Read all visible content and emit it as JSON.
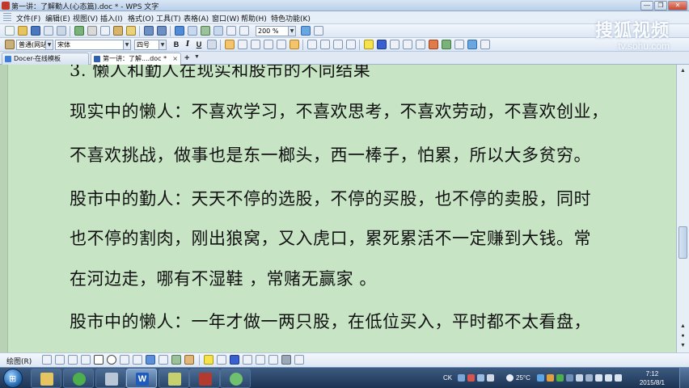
{
  "window": {
    "title": "第一讲：了解勤人(心态篇).doc * - WPS 文字",
    "minimize": "—",
    "restore": "❐",
    "close": "✕"
  },
  "menu": [
    "文件(F)",
    "编辑(E)",
    "视图(V)",
    "插入(I)",
    "格式(O)",
    "工具(T)",
    "表格(A)",
    "窗口(W)",
    "帮助(H)",
    "特色功能(K)"
  ],
  "toolbar": {
    "zoom": "200 %",
    "style": "普通(网站)",
    "font": "宋体",
    "size": "四号",
    "bold": "B",
    "italic": "I",
    "underline": "U"
  },
  "watermark": {
    "brand": "搜狐视频",
    "url": "tv.sohu.com"
  },
  "tabs": [
    {
      "label": "Docer-在线模板",
      "active": false
    },
    {
      "label": "第一讲：了解....doc *",
      "active": true
    }
  ],
  "new_tab": "+",
  "document": {
    "lines": [
      "3. 懒人和勤人在现实和股市的不同结果",
      "现实中的懒人：不喜欢学习，不喜欢思考，不喜欢劳动，不喜欢创业，",
      "不喜欢挑战，做事也是东一榔头，西一棒子，怕累，所以大多贫穷。",
      "股市中的勤人：天天不停的选股，不停的买股，也不停的卖股，同时",
      "也不停的割肉，刚出狼窝，又入虎口，累死累活不一定赚到大钱。常",
      "在河边走，哪有不湿鞋 ，常赌无赢家  。",
      "股市中的懒人：一年才做一两只股，在低位买入，平时都不太看盘，"
    ]
  },
  "drawbar": {
    "label": "绘图(R)"
  },
  "taskbar": {
    "start": "⊞",
    "tray_lang": "CK",
    "weather": "25°C",
    "time": "7:12",
    "date": "2015/8/1"
  }
}
